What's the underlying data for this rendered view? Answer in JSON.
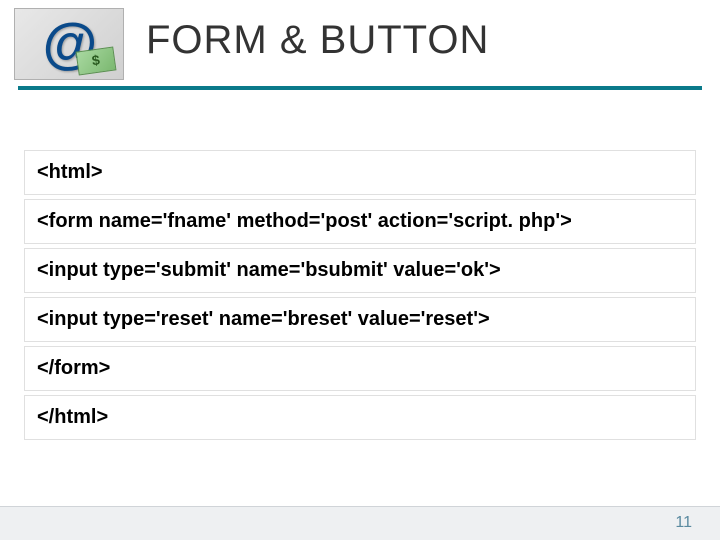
{
  "header": {
    "title": "FORM & BUTTON",
    "logo_symbol": "@"
  },
  "code_lines": [
    "<html>",
    "<form name='fname' method='post' action='script. php'>",
    "<input type='submit' name='bsubmit' value='ok'>",
    "<input type='reset' name='breset' value='reset'>",
    "</form>",
    "</html>"
  ],
  "page_number": "11"
}
